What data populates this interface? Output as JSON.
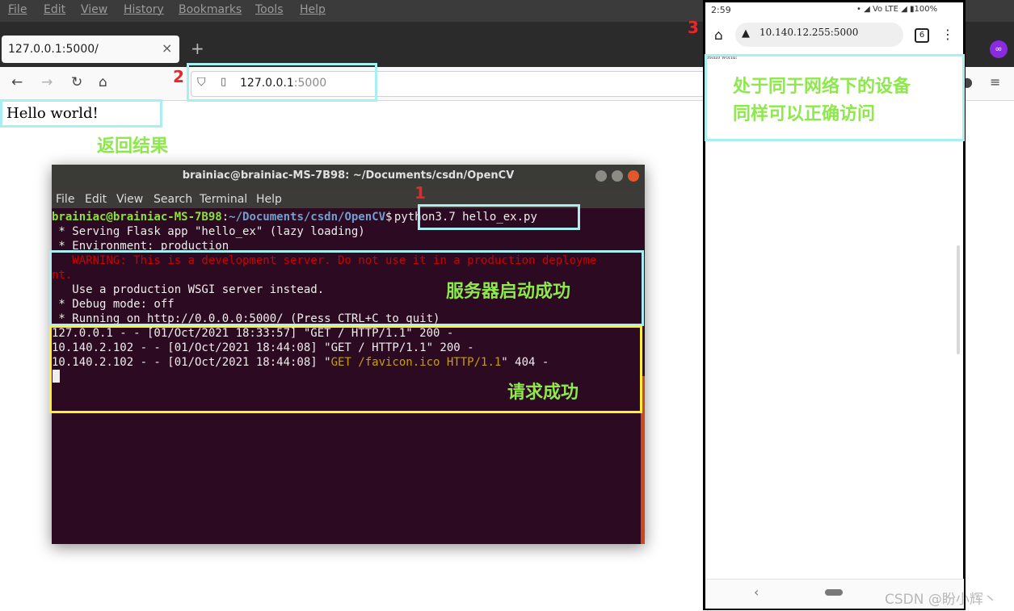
{
  "browser": {
    "menu": [
      "File",
      "Edit",
      "View",
      "History",
      "Bookmarks",
      "Tools",
      "Help"
    ],
    "tab_title": "127.0.0.1:5000/",
    "tab_close": "×",
    "new_tab": "+",
    "url_host": "127.0.0.1",
    "url_port": ":5000",
    "page_text": "Hello world!"
  },
  "annotations": {
    "num1": "1",
    "num2": "2",
    "num3": "3",
    "label_result": "返回结果",
    "label_server": "服务器启动成功",
    "label_request": "请求成功",
    "label_phone_line1": "处于同于网络下的设备",
    "label_phone_line2": "同样可以正确访问"
  },
  "terminal": {
    "title": "brainiac@brainiac-MS-7B98: ~/Documents/csdn/OpenCV",
    "menu": [
      "File",
      "Edit",
      "View",
      "Search",
      "Terminal",
      "Help"
    ],
    "prompt_user": "brainiac@brainiac-MS-7B98",
    "prompt_sep": ":",
    "prompt_path": "~/Documents/csdn/OpenCV",
    "prompt_dollar": "$ ",
    "command": "python3.7 hello_ex.py",
    "lines": [
      " * Serving Flask app \"hello_ex\" (lazy loading)",
      " * Environment: production",
      "   WARNING: This is a development server. Do not use it in a production deployme",
      "nt.",
      "   Use a production WSGI server instead.",
      " * Debug mode: off",
      " * Running on http://0.0.0.0:5000/ (Press CTRL+C to quit)",
      "127.0.0.1 - - [01/Oct/2021 18:33:57] \"GET / HTTP/1.1\" 200 -",
      "10.140.2.102 - - [01/Oct/2021 18:44:08] \"GET / HTTP/1.1\" 200 -"
    ],
    "last_prefix": "10.140.2.102 - - [01/Oct/2021 18:44:08] \"",
    "last_request": "GET /favicon.ico HTTP/1.1",
    "last_suffix": "\" 404 -"
  },
  "phone": {
    "time": "2:59",
    "status_right": "• ◢ Vo LTE ◢ ▮100%",
    "url": "10.140.12.255:5000",
    "tab_count": "6",
    "page_text": "Hello world!"
  },
  "watermark": "CSDN @盼小辉丶",
  "colors": {
    "annotation_cyan": "#a9eef0",
    "annotation_yellow": "#ffee33",
    "annotation_green": "#8de84b",
    "annotation_red": "#e8272a",
    "terminal_bg": "#2c0a22"
  }
}
